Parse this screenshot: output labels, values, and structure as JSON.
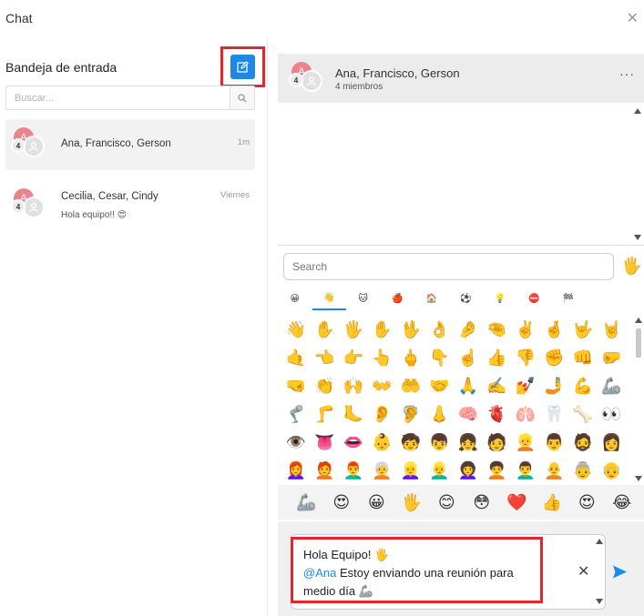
{
  "window": {
    "title": "Chat",
    "close_glyph": "✕"
  },
  "inbox": {
    "title": "Bandeja de entrada",
    "compose_icon": "edit-icon",
    "search_placeholder": "Buscar...",
    "conversations": [
      {
        "name": "Ana, Francisco, Gerson",
        "time": "1m",
        "preview": "",
        "avatar_letter": "A",
        "member_count": "4",
        "active": true
      },
      {
        "name": "Cecilia, Cesar, Cindy",
        "time": "Viernes",
        "preview": "Hola equipo!! 😍",
        "avatar_letter": "A",
        "member_count": "4",
        "active": false
      }
    ]
  },
  "chat": {
    "name": "Ana, Francisco, Gerson",
    "members": "4 miembros",
    "avatar_letter": "A",
    "member_count": "4",
    "more": "···"
  },
  "emoji_picker": {
    "search_placeholder": "Search",
    "skin_tone": "🖐️",
    "categories": [
      "😀",
      "👋",
      "🐱",
      "🍎",
      "🏠",
      "⚽",
      "💡",
      "⛔",
      "🏁"
    ],
    "active_category": 1,
    "grid": [
      "👋",
      "✋",
      "🖐️",
      "✋",
      "🖖",
      "👌",
      "🤌",
      "🤏",
      "✌️",
      "🤞",
      "🤟",
      "🤘",
      "🤙",
      "👈",
      "👉",
      "👆",
      "🖕",
      "👇",
      "☝️",
      "👍",
      "👎",
      "✊",
      "👊",
      "🤛",
      "🤜",
      "👏",
      "🙌",
      "👐",
      "🤲",
      "🤝",
      "🙏",
      "✍️",
      "💅",
      "🤳",
      "💪",
      "🦾",
      "🦿",
      "🦵",
      "🦶",
      "👂",
      "🦻",
      "👃",
      "🧠",
      "🫀",
      "🫁",
      "🦷",
      "🦴",
      "👀",
      "👁️",
      "👅",
      "👄",
      "👶",
      "🧒",
      "👦",
      "👧",
      "🧑",
      "👱",
      "👨",
      "🧔",
      "👩",
      "👩‍🦰",
      "🧑‍🦰",
      "👨‍🦰",
      "🧑‍🦳",
      "👱‍♀️",
      "👱‍♂️",
      "👩‍🦱",
      "🧑‍🦱",
      "👨‍🦱",
      "🧑‍🦲",
      "👵",
      "👴"
    ],
    "recent": [
      "🦾",
      "😍",
      "😀",
      "🖐️",
      "😊",
      "😳",
      "❤️",
      "👍",
      "😍",
      "😂"
    ]
  },
  "composer": {
    "line1": "Hola Equipo! 🖐️",
    "mention": "@Ana",
    "line2_rest": " Estoy enviando una reunión para",
    "line3": "medio día 🦾",
    "clear": "✕",
    "send_icon": "send-icon"
  },
  "colors": {
    "accent": "#1e88e5",
    "highlight": "#e8232b",
    "avatar": "#e9848c"
  }
}
